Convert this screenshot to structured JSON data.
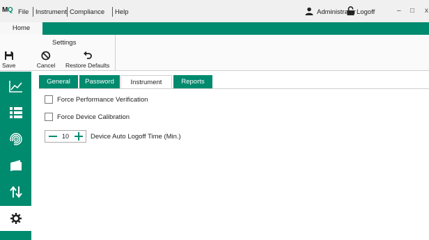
{
  "app": {
    "logo_m": "M",
    "logo_q": "Q",
    "menu": [
      "File",
      "Instrument",
      "Compliance",
      "Help"
    ]
  },
  "user": {
    "name": "Administrator",
    "logoff_label": "Logoff"
  },
  "window_controls": {
    "minimize": "–",
    "maximize": "□",
    "close": "x"
  },
  "ribbon": {
    "home_tab": "Home",
    "group_title": "Settings",
    "buttons": {
      "save": "Save",
      "cancel": "Cancel",
      "restore": "Restore Defaults"
    }
  },
  "nav": {
    "items": [
      "chart-icon",
      "list-icon",
      "fingerprint-icon",
      "folder-icon",
      "transfer-icon",
      "gear-icon"
    ],
    "active": "gear-icon"
  },
  "tabs": {
    "items": [
      "General",
      "Password",
      "Instrument",
      "Reports"
    ],
    "active": "Instrument"
  },
  "instrument": {
    "force_performance_verification": {
      "label": "Force Performance Verification",
      "checked": false
    },
    "force_device_calibration": {
      "label": "Force Device Calibration",
      "checked": false
    },
    "auto_logoff": {
      "label": "Device Auto Logoff Time (Min.)",
      "value": "10"
    }
  },
  "colors": {
    "accent": "#008a6e"
  }
}
